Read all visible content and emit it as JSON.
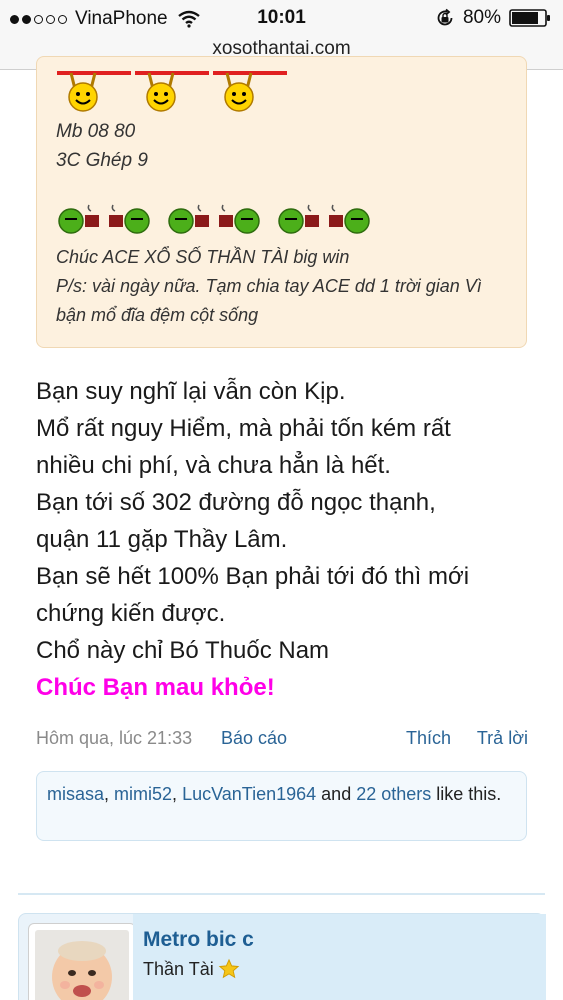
{
  "status_bar": {
    "carrier": "VinaPhone",
    "time": "10:01",
    "battery": "80%",
    "signal_bars": 2
  },
  "browser": {
    "url": "xosothantai.com"
  },
  "quote": {
    "line1": "Mb 08 80",
    "line2": "3C Ghép 9",
    "wish": "Chúc ACE XỔ SỐ THẦN TÀI big win",
    "ps": "P/s: vài ngày nữa. Tạm chia tay ACE dd 1 trời gian Vì bận mổ đĩa đệm cột sống"
  },
  "post": {
    "lines": [
      "Bạn suy nghĩ lại vẫn còn Kịp.",
      "Mổ rất nguy Hiểm, mà phải tốn kém rất",
      "nhiều chi phí, và chưa hẳn là hết.",
      "Bạn tới số 302 đường đỗ ngọc thạnh,",
      "quận 11 gặp Thầy Lâm.",
      "Bạn sẽ hết 100% Bạn phải tới đó thì mới",
      "chứng kiến được.",
      "Chổ này chỉ Bó Thuốc Nam"
    ],
    "closing": "Chúc Bạn mau khỏe!",
    "closing_color": "#ff00e8"
  },
  "meta": {
    "timestamp": "Hôm qua, lúc 21:33",
    "report": "Báo cáo",
    "like": "Thích",
    "reply": "Trả lời"
  },
  "likes": {
    "user1": "misasa",
    "sep1": ", ",
    "user2": "mimi52",
    "sep2": ", ",
    "user3": "LucVanTien1964",
    "and": " and ",
    "others": "22 others",
    "suffix": " like this."
  },
  "next_post": {
    "username": "Metro bic c",
    "title": "Thần Tài"
  },
  "colors": {
    "link": "#2a6496",
    "quote_bg": "#fdf1df",
    "username": "#1e5e93"
  },
  "icons": [
    "wifi-icon",
    "lock-rotation-icon",
    "battery-icon",
    "cheering-smiley-icon",
    "coffee-smiley-icon",
    "star-icon"
  ]
}
